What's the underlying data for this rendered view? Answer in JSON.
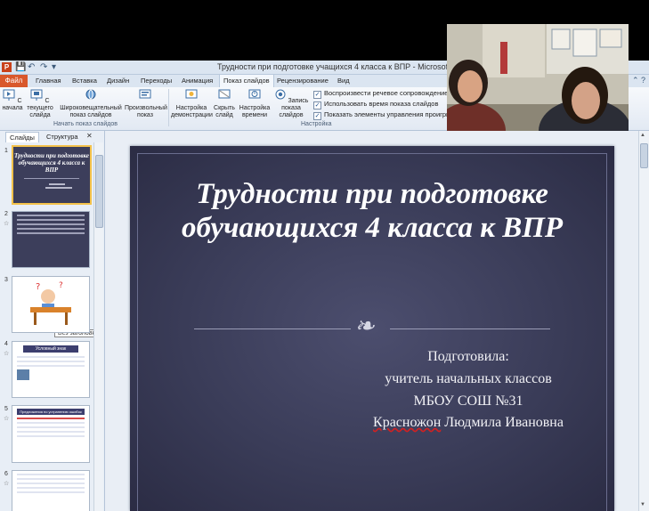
{
  "app": {
    "icon_label": "P",
    "window_title": "Трудности при подготовке учащихся 4 класса к ВПР  -  Microsoft PowerPoint"
  },
  "quick_access": {
    "save": "💾",
    "undo": "↶",
    "redo": "↷",
    "customize": "▾"
  },
  "tabs": {
    "file": "Файл",
    "items": [
      "Главная",
      "Вставка",
      "Дизайн",
      "Переходы",
      "Анимация",
      "Показ слайдов",
      "Рецензирование",
      "Вид"
    ],
    "active": "Показ слайдов"
  },
  "ribbon": {
    "from_start": "С начала",
    "from_current": "С текущего слайда",
    "broadcast": "Широковещательный показ слайдов",
    "custom_show": "Произвольный показ",
    "group_start": "Начать показ слайдов",
    "setup_show": "Настройка демонстрации",
    "hide_slide": "Скрыть слайд",
    "rehearse": "Настройка времени",
    "record": "Запись показа слайдов",
    "play_narrations": "Воспроизвести речевое сопровождение",
    "use_timings": "Использовать время показа слайдов",
    "show_controls": "Показать элементы управления проигрывателем",
    "group_setup": "Настройка"
  },
  "left_panel": {
    "tab_slides": "Слайды",
    "tab_outline": "Структура",
    "tooltip": "Без заголовка",
    "slide_numbers": [
      "1",
      "2",
      "3",
      "4",
      "5",
      "6"
    ],
    "thumb4_title": "Условный знак",
    "thumb5_title": "Предложения по устранению ошибок"
  },
  "slide": {
    "title": "Трудности при подготовке обучающихся 4 класса к ВПР",
    "ornament": "❧",
    "author_line1": "Подготовила:",
    "author_line2": "учитель начальных классов",
    "author_line3": "МБОУ СОШ №31",
    "author_surname": "Красножон",
    "author_rest": " Людмила Ивановна"
  },
  "colors": {
    "file_tab": "#d9582b",
    "slide_background": "#3a3c58",
    "ribbon": "#f3f7fc"
  }
}
